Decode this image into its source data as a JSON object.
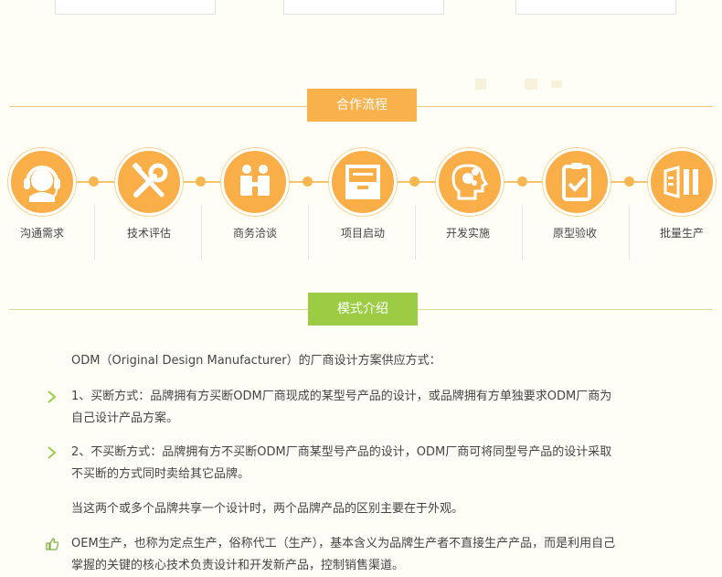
{
  "sections": {
    "process_title": "合作流程",
    "mode_title": "模式介绍"
  },
  "colors": {
    "orange": "#f9b14c",
    "green": "#9ccc43",
    "line": "#f0c978"
  },
  "steps": [
    {
      "label": "沟通需求",
      "icon": "headset-icon"
    },
    {
      "label": "技术评估",
      "icon": "tools-icon"
    },
    {
      "label": "商务洽谈",
      "icon": "handshake-icon"
    },
    {
      "label": "项目启动",
      "icon": "inbox-tray-icon"
    },
    {
      "label": "开发实施",
      "icon": "head-gears-icon"
    },
    {
      "label": "原型验收",
      "icon": "clipboard-check-icon"
    },
    {
      "label": "批量生产",
      "icon": "production-icon"
    }
  ],
  "content": {
    "intro": "ODM（Original Design Manufacturer）的厂商设计方案供应方式：",
    "item1": "1、买断方式：品牌拥有方买断ODM厂商现成的某型号产品的设计，或品牌拥有方单独要求ODM厂商为自己设计产品方案。",
    "item2": "2、不买断方式：品牌拥有方不买断ODM厂商某型号产品的设计，ODM厂商可将同型号产品的设计采取不买断的方式同时卖给其它品牌。",
    "note": "当这两个或多个品牌共享一个设计时，两个品牌产品的区别主要在于外观。",
    "oem": "OEM生产，也称为定点生产，俗称代工（生产），基本含义为品牌生产者不直接生产产品，而是利用自己掌握的关键的核心技术负责设计和开发新产品，控制销售渠道。"
  }
}
